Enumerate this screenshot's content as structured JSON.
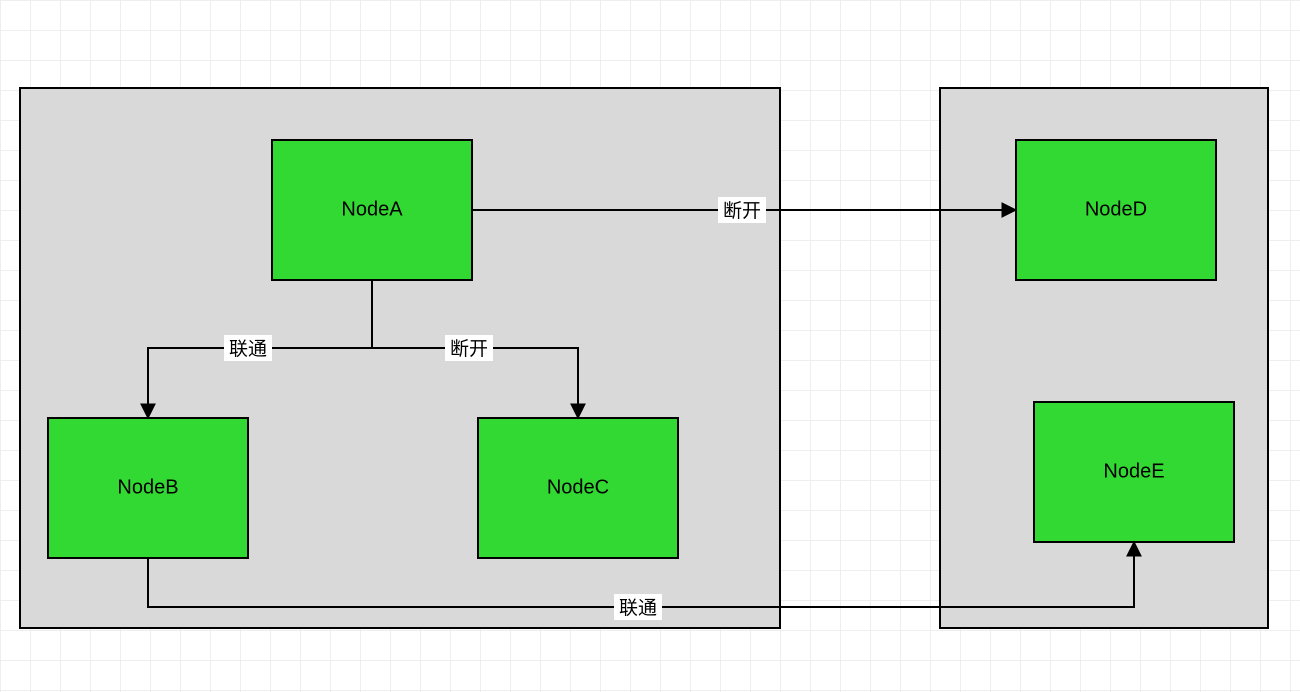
{
  "nodes": {
    "a": "NodeA",
    "b": "NodeB",
    "c": "NodeC",
    "d": "NodeD",
    "e": "NodeE"
  },
  "edges": {
    "a_to_d": "断开",
    "a_to_b": "联通",
    "a_to_c": "断开",
    "b_to_e": "联通"
  }
}
